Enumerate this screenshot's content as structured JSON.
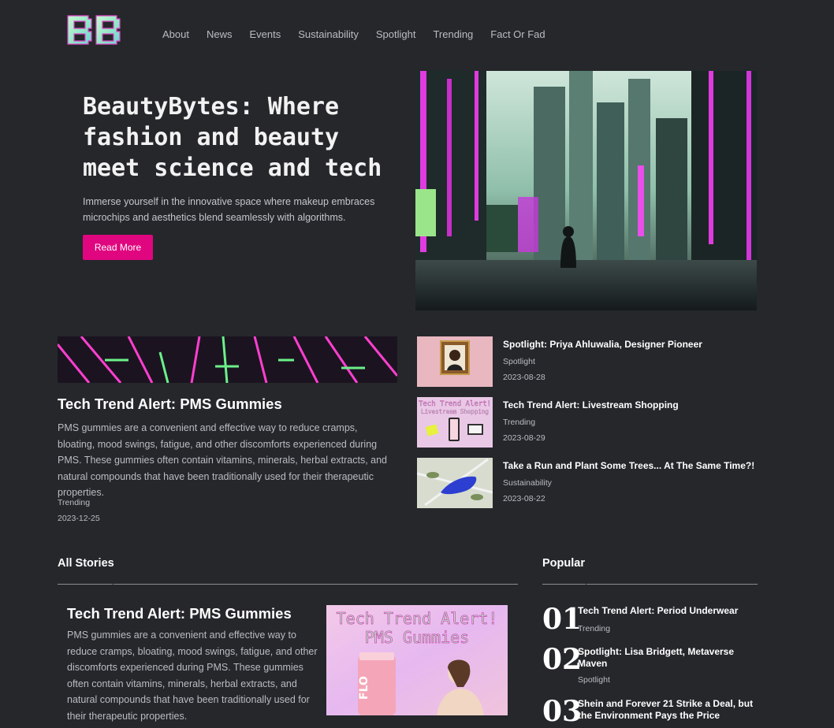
{
  "brand": {
    "logo_text": "BB"
  },
  "nav": [
    "About",
    "News",
    "Events",
    "Sustainability",
    "Spotlight",
    "Trending",
    "Fact Or Fad"
  ],
  "hero": {
    "title": "BeautyBytes: Where fashion and beauty meet science and tech",
    "subtitle": "Immerse yourself in the innovative space where makeup embraces microchips and aesthetics blend seamlessly with algorithms.",
    "button": "Read More"
  },
  "featured": {
    "title": "Tech Trend Alert: PMS Gummies",
    "text": "PMS gummies are a convenient and effective way to reduce cramps, bloating, mood swings, fatigue, and other discomforts experienced during PMS. These gummies often contain vitamins, minerals, herbal extracts, and natural compounds that have been traditionally used for their therapeutic properties.",
    "category": "Trending",
    "date": "2023-12-25"
  },
  "side_articles": [
    {
      "title": "Spotlight: Priya Ahluwalia, Designer Pioneer",
      "category": "Spotlight",
      "date": "2023-08-28"
    },
    {
      "title": "Tech Trend Alert: Livestream Shopping",
      "category": "Trending",
      "date": "2023-08-29",
      "thumb_text_1": "Tech Trend Alert!",
      "thumb_text_2": "Livestream Shopping"
    },
    {
      "title": "Take a Run and Plant Some Trees... At The Same Time?!",
      "category": "Sustainability",
      "date": "2023-08-22"
    }
  ],
  "all_stories": {
    "heading": "All Stories",
    "story": {
      "title": "Tech Trend Alert: PMS Gummies",
      "text": "PMS gummies are a convenient and effective way to reduce cramps, bloating, mood swings, fatigue, and other discomforts experienced during PMS. These gummies often contain vitamins, minerals, herbal extracts, and natural compounds that have been traditionally used for their therapeutic properties.",
      "image_text_1": "Tech Trend Alert!",
      "image_text_2": "PMS Gummies",
      "image_product_text": "FLO"
    }
  },
  "popular": {
    "heading": "Popular",
    "items": [
      {
        "num": "01",
        "title": "Tech Trend Alert: Period Underwear",
        "category": "Trending"
      },
      {
        "num": "02",
        "title": "Spotlight: Lisa Bridgett, Metaverse Maven",
        "category": "Spotlight"
      },
      {
        "num": "03",
        "title": "Shein and Forever 21 Strike a Deal, but the Environment Pays the Price",
        "category": ""
      }
    ]
  },
  "colors": {
    "background": "#25272b",
    "accent": "#e0067f",
    "logo": "#9ff0c8"
  }
}
